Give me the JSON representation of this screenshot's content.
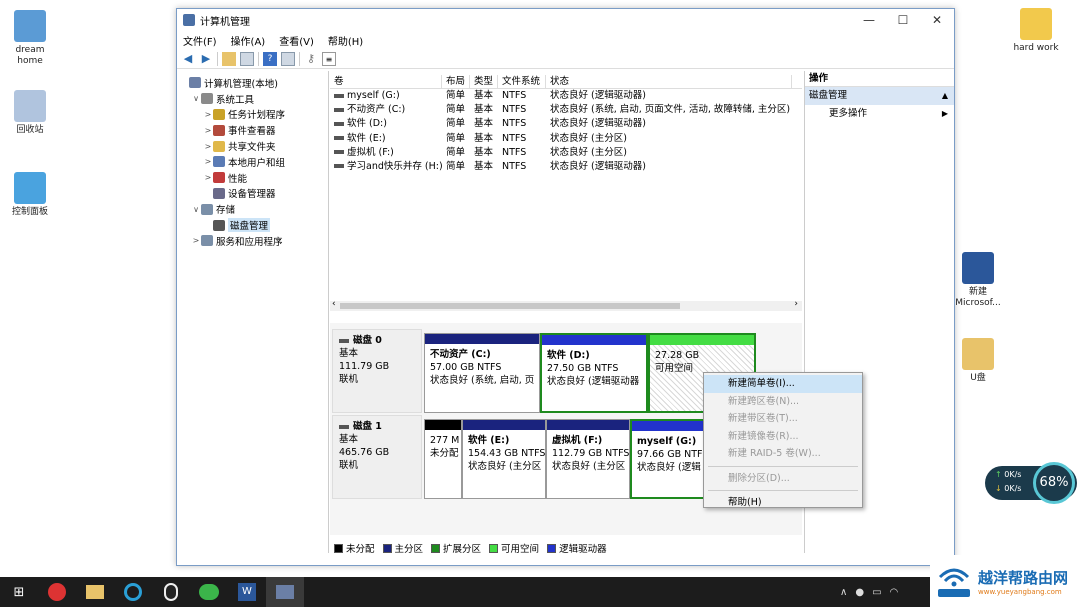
{
  "desktop": {
    "icons_left": [
      {
        "label1": "dream",
        "label2": "home",
        "color": "#5b9bd5"
      },
      {
        "label1": "回收站",
        "label2": "",
        "color": "#b0c4de"
      },
      {
        "label1": "控制面板",
        "label2": "",
        "color": "#4aa3df"
      }
    ],
    "icons_right": [
      {
        "label1": "hard work",
        "label2": "",
        "color": "#f2c94c"
      },
      {
        "label1": "新建",
        "label2": "Microsof...",
        "color": "#2b579a"
      },
      {
        "label1": "U盘",
        "label2": "",
        "color": "#e8c36a"
      }
    ]
  },
  "window": {
    "title": "计算机管理",
    "menu": [
      "文件(F)",
      "操作(A)",
      "查看(V)",
      "帮助(H)"
    ]
  },
  "tree": [
    {
      "indent": 0,
      "arrow": "",
      "label": "计算机管理(本地)",
      "color": "#6b7fa6"
    },
    {
      "indent": 1,
      "arrow": "∨",
      "label": "系统工具",
      "color": "#8a8a8a"
    },
    {
      "indent": 2,
      "arrow": ">",
      "label": "任务计划程序",
      "color": "#c9a227"
    },
    {
      "indent": 2,
      "arrow": ">",
      "label": "事件查看器",
      "color": "#b34a3c"
    },
    {
      "indent": 2,
      "arrow": ">",
      "label": "共享文件夹",
      "color": "#e0b84a"
    },
    {
      "indent": 2,
      "arrow": ">",
      "label": "本地用户和组",
      "color": "#5a7bb5"
    },
    {
      "indent": 2,
      "arrow": ">",
      "label": "性能",
      "color": "#c23b3b"
    },
    {
      "indent": 2,
      "arrow": "",
      "label": "设备管理器",
      "color": "#6a6a8a"
    },
    {
      "indent": 1,
      "arrow": "∨",
      "label": "存储",
      "color": "#7a8fa8"
    },
    {
      "indent": 2,
      "arrow": "",
      "label": "磁盘管理",
      "color": "#555",
      "selected": true
    },
    {
      "indent": 1,
      "arrow": ">",
      "label": "服务和应用程序",
      "color": "#7a8fa8"
    }
  ],
  "volumes": {
    "headers": [
      "卷",
      "布局",
      "类型",
      "文件系统",
      "状态"
    ],
    "rows": [
      [
        "myself (G:)",
        "简单",
        "基本",
        "NTFS",
        "状态良好 (逻辑驱动器)"
      ],
      [
        "不动资产 (C:)",
        "简单",
        "基本",
        "NTFS",
        "状态良好 (系统, 启动, 页面文件, 活动, 故障转储, 主分区)"
      ],
      [
        "软件 (D:)",
        "简单",
        "基本",
        "NTFS",
        "状态良好 (逻辑驱动器)"
      ],
      [
        "软件 (E:)",
        "简单",
        "基本",
        "NTFS",
        "状态良好 (主分区)"
      ],
      [
        "虚拟机 (F:)",
        "简单",
        "基本",
        "NTFS",
        "状态良好 (主分区)"
      ],
      [
        "学习and快乐并存 (H:)",
        "简单",
        "基本",
        "NTFS",
        "状态良好 (逻辑驱动器)"
      ]
    ]
  },
  "disks": [
    {
      "name": "磁盘 0",
      "type": "基本",
      "size": "111.79 GB",
      "status": "联机",
      "partitions": [
        {
          "name": "不动资产 (C:)",
          "size": "57.00 GB NTFS",
          "status": "状态良好 (系统, 启动, 页",
          "bar": "#1a237e",
          "kind": "primary"
        },
        {
          "name": "软件 (D:)",
          "size": "27.50 GB NTFS",
          "status": "状态良好 (逻辑驱动器",
          "bar": "#2233cc",
          "kind": "ext"
        },
        {
          "name": "",
          "size": "27.28 GB",
          "status": "可用空间",
          "bar": "#44dd44",
          "kind": "free"
        }
      ]
    },
    {
      "name": "磁盘 1",
      "type": "基本",
      "size": "465.76 GB",
      "status": "联机",
      "partitions": [
        {
          "name": "",
          "size": "277 M",
          "status": "未分配",
          "bar": "#000000",
          "kind": "unalloc"
        },
        {
          "name": "软件 (E:)",
          "size": "154.43 GB NTFS",
          "status": "状态良好 (主分区",
          "bar": "#1a237e",
          "kind": "primary"
        },
        {
          "name": "虚拟机 (F:)",
          "size": "112.79 GB NTFS",
          "status": "状态良好 (主分区",
          "bar": "#1a237e",
          "kind": "primary"
        },
        {
          "name": "myself (G:)",
          "size": "97.66 GB NTFS",
          "status": "状态良好 (逻辑",
          "bar": "#2233cc",
          "kind": "ext"
        }
      ]
    }
  ],
  "legend": [
    {
      "label": "未分配",
      "color": "#000000"
    },
    {
      "label": "主分区",
      "color": "#1a237e"
    },
    {
      "label": "扩展分区",
      "color": "#1e8a1e"
    },
    {
      "label": "可用空间",
      "color": "#44dd44"
    },
    {
      "label": "逻辑驱动器",
      "color": "#2233cc"
    }
  ],
  "actions": {
    "header": "操作",
    "section": "磁盘管理",
    "item": "更多操作"
  },
  "context_menu": [
    {
      "label": "新建简单卷(I)...",
      "enabled": true,
      "highlight": true
    },
    {
      "label": "新建跨区卷(N)...",
      "enabled": false
    },
    {
      "label": "新建带区卷(T)...",
      "enabled": false
    },
    {
      "label": "新建镜像卷(R)...",
      "enabled": false
    },
    {
      "label": "新建 RAID-5 卷(W)...",
      "enabled": false
    },
    {
      "sep": true
    },
    {
      "label": "删除分区(D)...",
      "enabled": false
    },
    {
      "sep": true
    },
    {
      "label": "帮助(H)",
      "enabled": true
    }
  ],
  "net_widget": {
    "up": "0K/s",
    "down": "0K/s",
    "percent": "68%"
  },
  "watermark": {
    "title": "越洋帮路由网",
    "url": "www.yueyangbang.com"
  }
}
